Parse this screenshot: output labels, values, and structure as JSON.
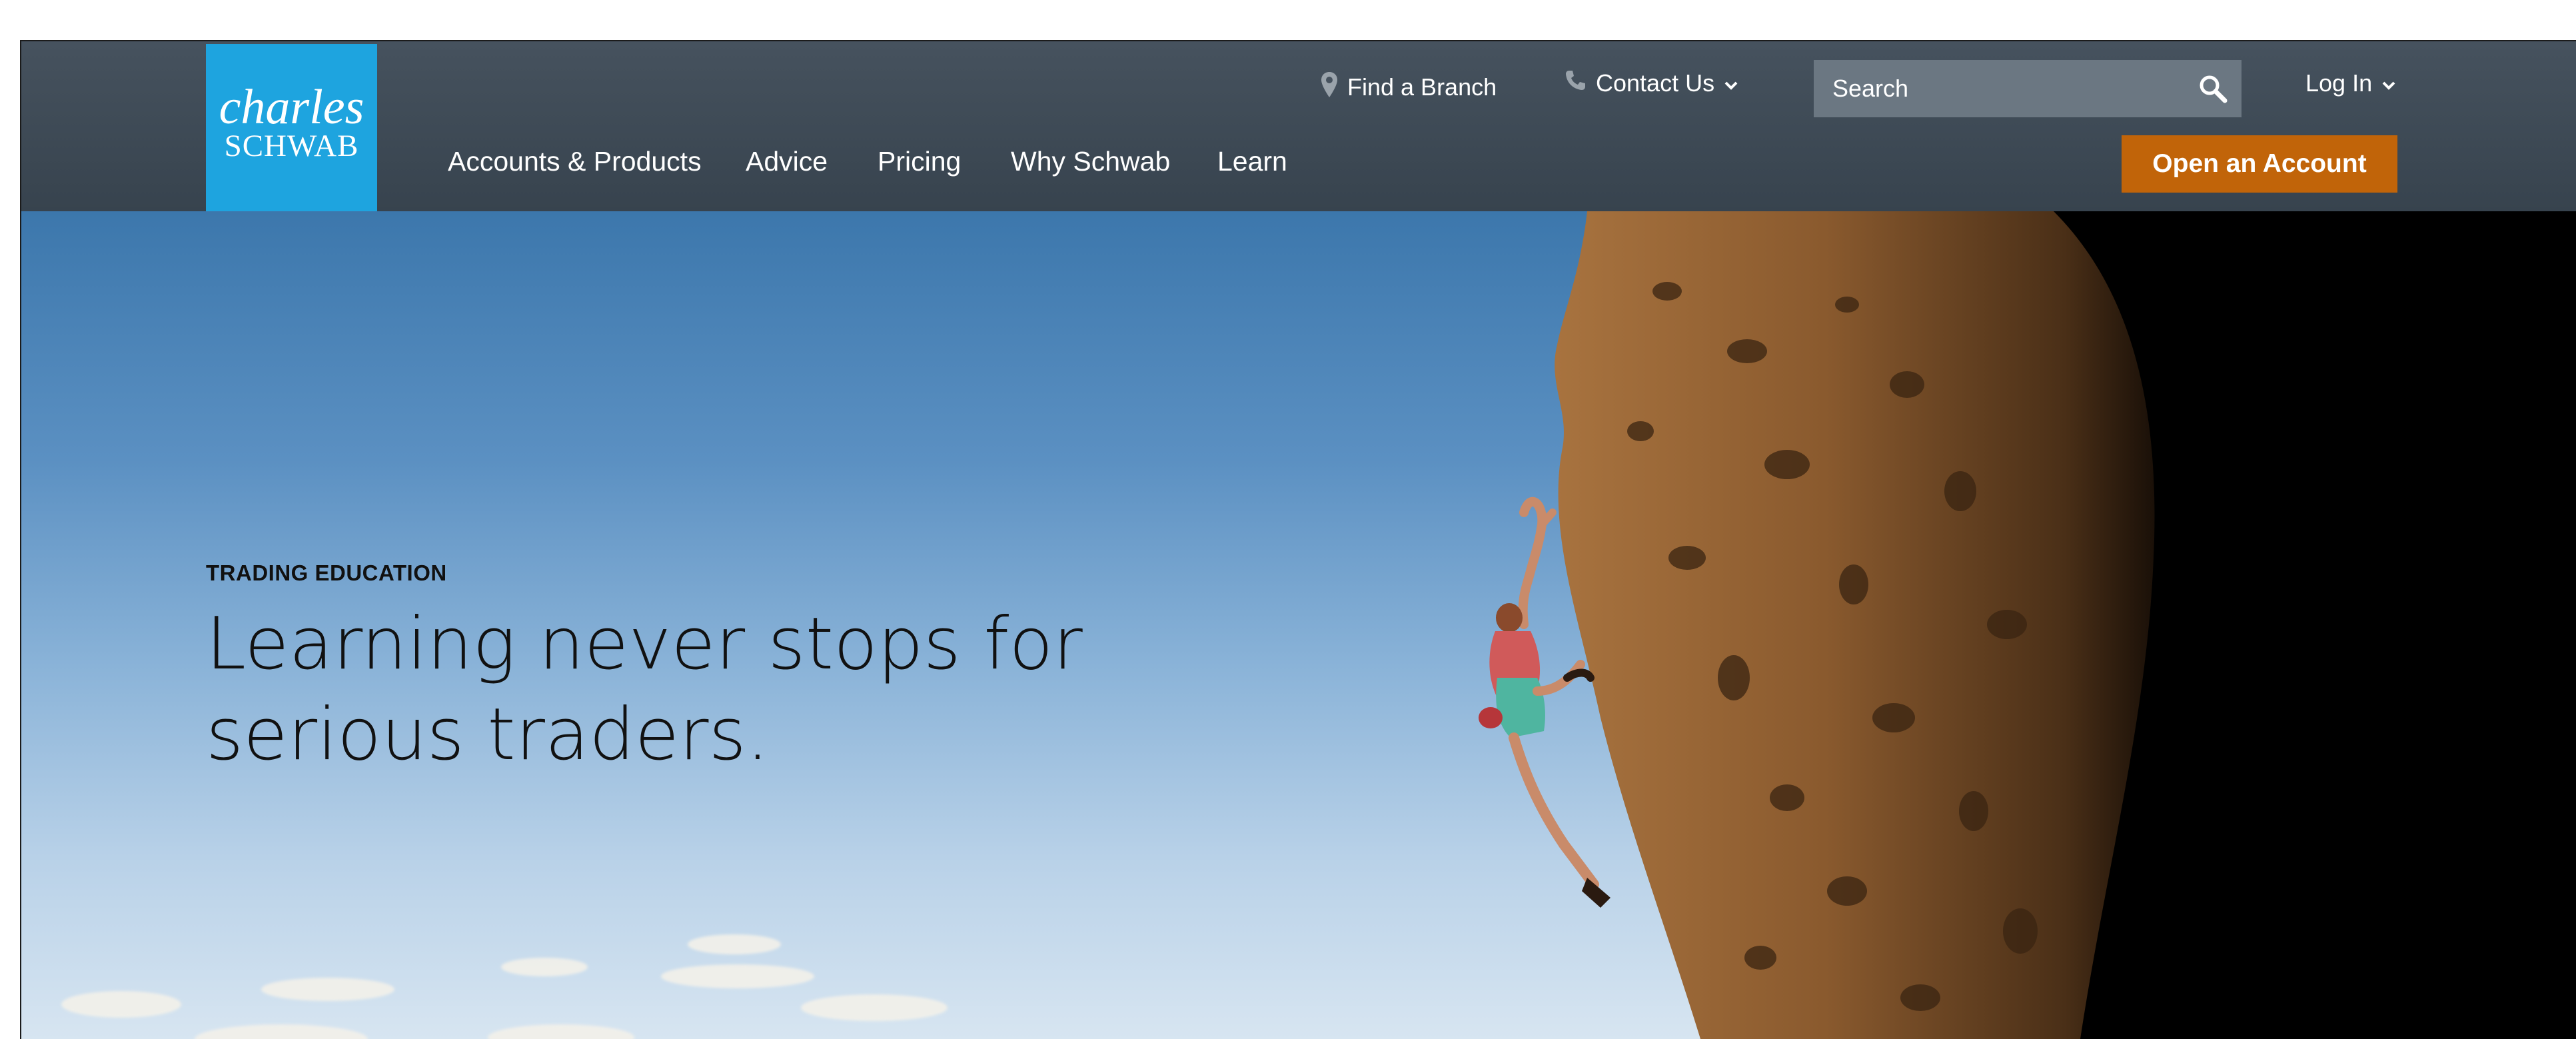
{
  "logo": {
    "line1": "charles",
    "line2": "SCHWAB"
  },
  "utility": {
    "find_branch": "Find a Branch",
    "contact_us": "Contact Us",
    "search_placeholder": "Search",
    "login": "Log In"
  },
  "nav": {
    "items": [
      {
        "label": "Accounts & Products"
      },
      {
        "label": "Advice"
      },
      {
        "label": "Pricing"
      },
      {
        "label": "Why Schwab"
      },
      {
        "label": "Learn"
      }
    ]
  },
  "cta": {
    "label": "Open an Account"
  },
  "hero": {
    "eyebrow": "TRADING EDUCATION",
    "headline_line1": "Learning never stops for",
    "headline_line2": "serious traders."
  },
  "colors": {
    "header": "#3d4955",
    "logo_bg": "#1ea4df",
    "cta_bg": "#c16409",
    "search_bg": "#6b7782"
  },
  "icons": [
    "location-pin-icon",
    "phone-icon",
    "chevron-down-icon",
    "search-icon"
  ]
}
